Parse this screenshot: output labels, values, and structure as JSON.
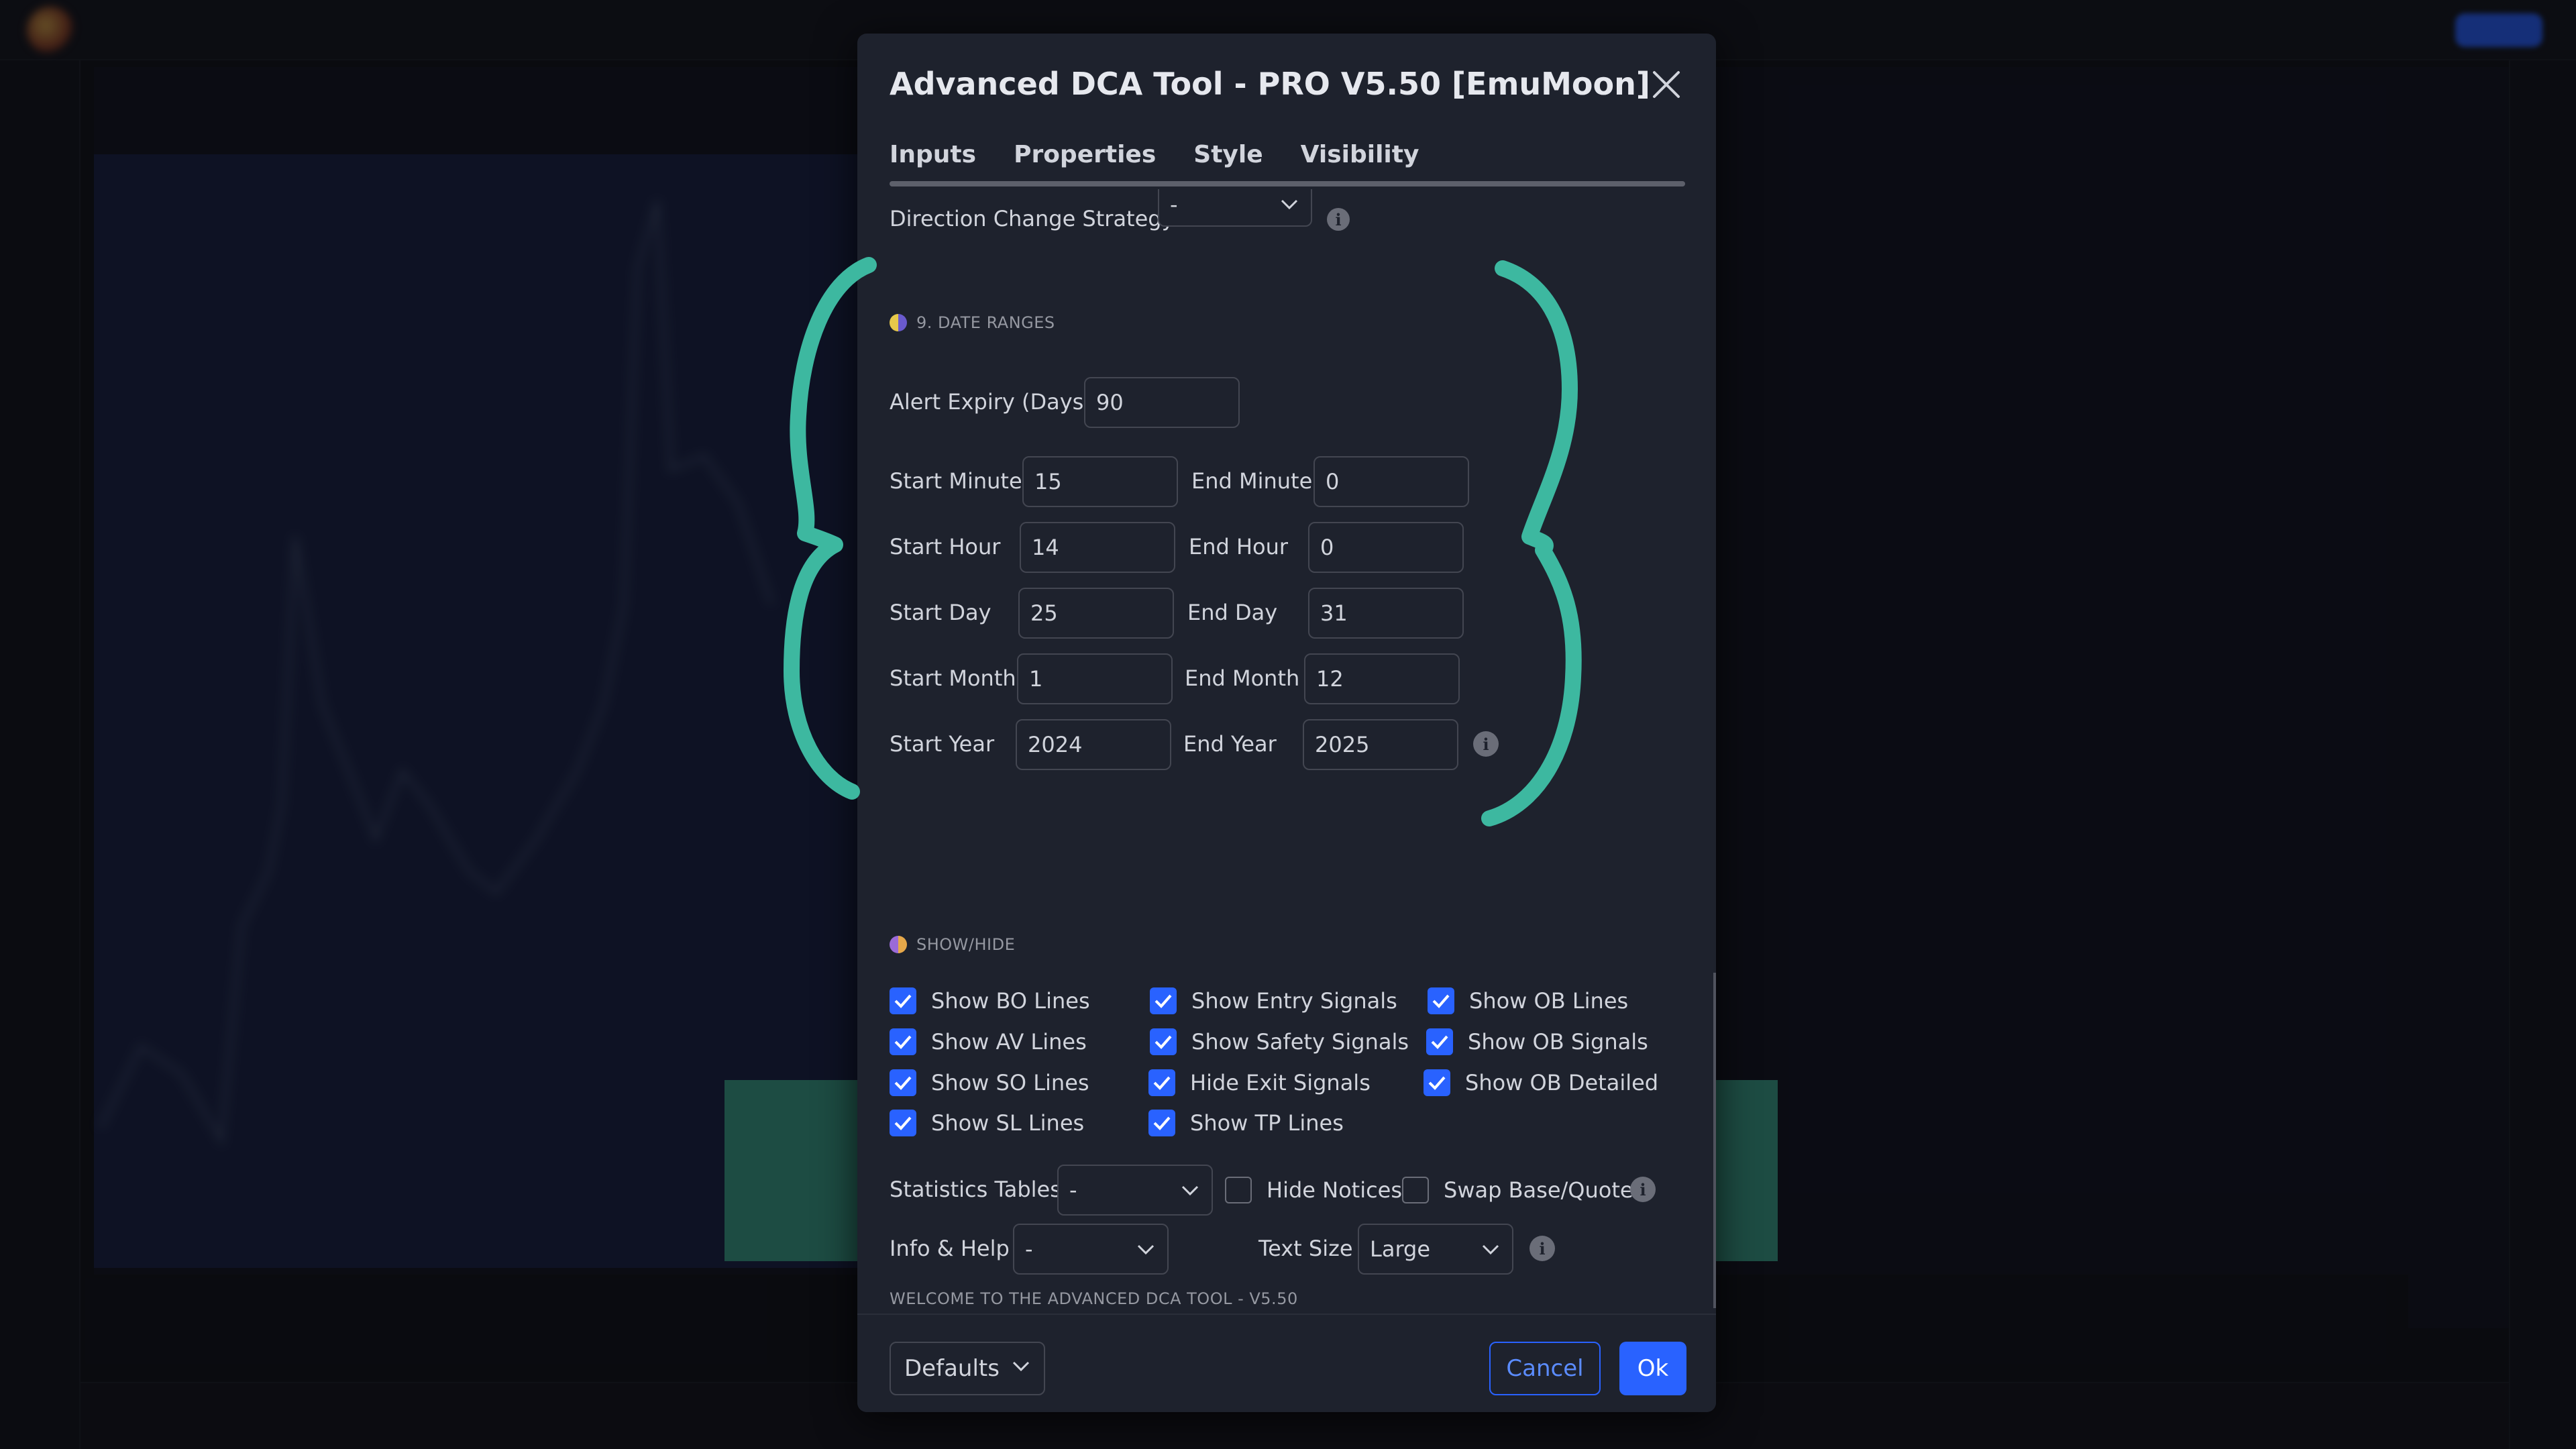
{
  "dialog": {
    "title": "Advanced DCA Tool - PRO V5.50 [EmuMoon]",
    "tabs": [
      {
        "label": "Inputs"
      },
      {
        "label": "Properties"
      },
      {
        "label": "Style"
      },
      {
        "label": "Visibility"
      }
    ]
  },
  "partial_row": {
    "label": "Direction Change Strategy",
    "value": "-"
  },
  "date_ranges": {
    "heading": "9. DATE RANGES",
    "alert_expiry": {
      "label": "Alert Expiry (Days)",
      "value": "90"
    },
    "start_minute": {
      "label": "Start Minute",
      "value": "15"
    },
    "end_minute": {
      "label": "End Minute",
      "value": "0"
    },
    "start_hour": {
      "label": "Start Hour",
      "value": "14"
    },
    "end_hour": {
      "label": "End Hour",
      "value": "0"
    },
    "start_day": {
      "label": "Start Day",
      "value": "25"
    },
    "end_day": {
      "label": "End Day",
      "value": "31"
    },
    "start_month": {
      "label": "Start Month",
      "value": "1"
    },
    "end_month": {
      "label": "End Month",
      "value": "12"
    },
    "start_year": {
      "label": "Start Year",
      "value": "2024"
    },
    "end_year": {
      "label": "End Year",
      "value": "2025"
    }
  },
  "show_hide": {
    "heading": "SHOW/HIDE",
    "checkboxes": [
      {
        "label": "Show BO Lines",
        "checked": true
      },
      {
        "label": "Show Entry Signals",
        "checked": true
      },
      {
        "label": "Show OB Lines",
        "checked": true
      },
      {
        "label": "Show AV Lines",
        "checked": true
      },
      {
        "label": "Show Safety Signals",
        "checked": true
      },
      {
        "label": "Show OB Signals",
        "checked": true
      },
      {
        "label": "Show SO Lines",
        "checked": true
      },
      {
        "label": "Hide Exit Signals",
        "checked": true
      },
      {
        "label": "Show OB Detailed",
        "checked": true
      },
      {
        "label": "Show SL Lines",
        "checked": true
      },
      {
        "label": "Show TP Lines",
        "checked": true
      }
    ],
    "statistics_tables": {
      "label": "Statistics Tables",
      "value": "-"
    },
    "hide_notices": {
      "label": "Hide Notices",
      "checked": false
    },
    "swap_base_quote": {
      "label": "Swap Base/Quote",
      "checked": false
    }
  },
  "welcome": {
    "heading": "WELCOME TO THE ADVANCED DCA TOOL - V5.50",
    "info_help": {
      "label": "Info & Help",
      "value": "-"
    },
    "text_size": {
      "label": "Text Size",
      "value": "Large"
    }
  },
  "footer": {
    "defaults_label": "Defaults",
    "cancel_label": "Cancel",
    "ok_label": "Ok"
  },
  "colors": {
    "accent": "#2962ff",
    "annotation": "#3db8a0",
    "dialog_bg": "#1e222d"
  },
  "icons": [
    "close-icon",
    "chevron-down-icon",
    "info-icon",
    "checkmark-icon"
  ]
}
